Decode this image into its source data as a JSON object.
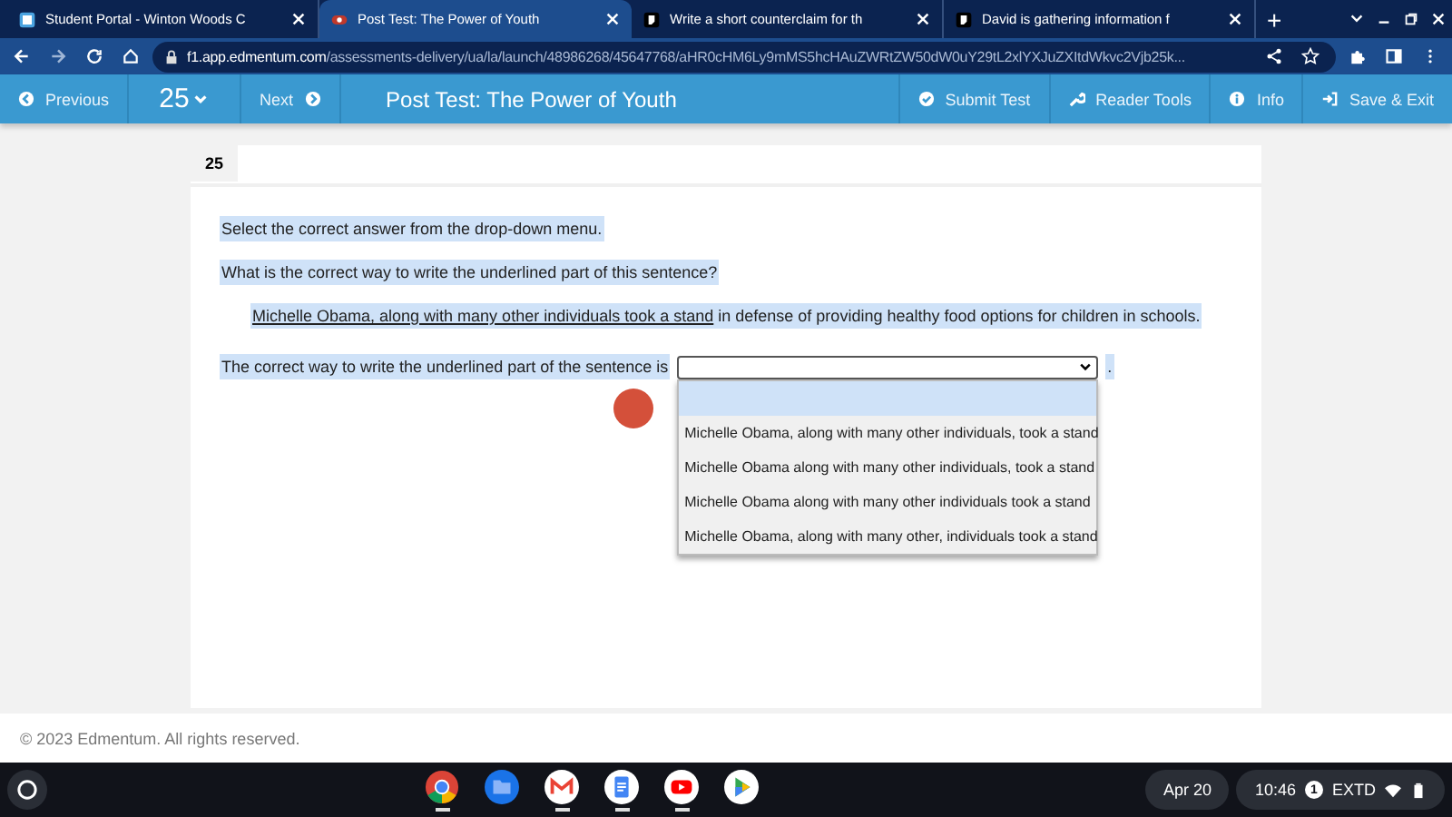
{
  "browser": {
    "tabs": [
      {
        "title": "Student Portal - Winton Woods C",
        "selected": false,
        "kind": "portal"
      },
      {
        "title": "Post Test: The Power of Youth",
        "selected": true,
        "kind": "edmentum"
      },
      {
        "title": "Write a short counterclaim for th",
        "selected": false,
        "kind": "brainly"
      },
      {
        "title": "David is gathering information f",
        "selected": false,
        "kind": "brainly"
      }
    ],
    "new_tab": "+",
    "url_host": "f1.app.edmentum.com",
    "url_path": "/assessments-delivery/ua/la/launch/48986268/45647768/aHR0cHM6Ly9mMS5hcHAuZWRtZW50dW0uY29tL2xlYXJuZXItdWkvc2Vjb25k..."
  },
  "toolbar": {
    "previous": "Previous",
    "question_number": "25",
    "next": "Next",
    "title": "Post Test: The Power of Youth",
    "actions": [
      {
        "label": "Submit Test",
        "kind": "check"
      },
      {
        "label": "Reader Tools",
        "kind": "wrench"
      },
      {
        "label": "Info",
        "kind": "info"
      },
      {
        "label": "Save & Exit",
        "kind": "exit"
      }
    ]
  },
  "question": {
    "number": "25",
    "instruction": "Select the correct answer from the drop-down menu.",
    "prompt": "What is the correct way to write the underlined part of this sentence?",
    "sentence_underlined": "Michelle Obama, along with many other individuals took a stand",
    "sentence_rest": " in defense of providing healthy food options for children in schools.",
    "answer_label": "The correct way to write the underlined part of the sentence is",
    "answer_end": ".",
    "dropdown": {
      "expanded": true,
      "options": [
        {
          "selected": true
        },
        {
          "text": "Michelle Obama, along with many other individuals, took a stand",
          "selected": false
        },
        {
          "text": "Michelle Obama along with many other individuals, took a stand",
          "selected": false
        },
        {
          "text": "Michelle Obama along with many other individuals took a stand",
          "selected": false
        },
        {
          "text": "Michelle Obama, along with many other, individuals took a stand",
          "selected": false
        }
      ]
    }
  },
  "footer": "© 2023 Edmentum. All rights reserved.",
  "taskbar": {
    "apps": [
      {
        "kind": "chrome",
        "running": true
      },
      {
        "kind": "files",
        "running": false
      },
      {
        "kind": "gmail",
        "running": true
      },
      {
        "kind": "docs",
        "running": true
      },
      {
        "kind": "youtube",
        "running": true
      },
      {
        "kind": "play",
        "running": false
      }
    ],
    "date": "Apr 20",
    "time": "10:46",
    "notification_count": "1",
    "keyboard": "EXTD"
  }
}
